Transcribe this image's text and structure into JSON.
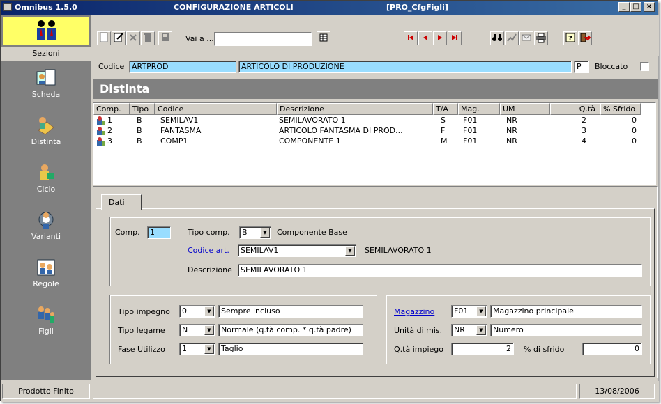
{
  "window": {
    "app_title": "Omnibus 1.5.0",
    "form_title": "CONFIGURAZIONE ARTICOLI",
    "form_code": "[PRO_CfgFigli]",
    "minimize": "_",
    "maximize": "□",
    "close": "×"
  },
  "sidebar": {
    "header": "Sezioni",
    "items": [
      {
        "label": "Scheda",
        "icon": "scheda-icon"
      },
      {
        "label": "Distinta",
        "icon": "distinta-icon"
      },
      {
        "label": "Ciclo",
        "icon": "ciclo-icon"
      },
      {
        "label": "Varianti",
        "icon": "varianti-icon"
      },
      {
        "label": "Regole",
        "icon": "regole-icon"
      },
      {
        "label": "Figli",
        "icon": "figli-icon"
      }
    ]
  },
  "toolbar": {
    "goto_label": "Vai a ...",
    "goto_value": ""
  },
  "header": {
    "codice_label": "Codice",
    "codice_value": "ARTPROD",
    "descrizione_value": "ARTICOLO DI PRODUZIONE",
    "tipo_value": "P",
    "bloccato_label": "Bloccato"
  },
  "distinta": {
    "title": "Distinta",
    "columns": [
      "Comp.",
      "Tipo",
      "Codice",
      "Descrizione",
      "T/A",
      "Mag.",
      "UM",
      "Q.tà",
      "% Sfrido"
    ],
    "rows": [
      {
        "comp": "1",
        "tipo": "B",
        "codice": "SEMILAV1",
        "descrizione": "SEMILAVORATO 1",
        "ta": "S",
        "mag": "F01",
        "um": "NR",
        "qta": "2",
        "sfrido": "0"
      },
      {
        "comp": "2",
        "tipo": "B",
        "codice": "FANTASMA",
        "descrizione": "ARTICOLO FANTASMA DI PROD...",
        "ta": "F",
        "mag": "F01",
        "um": "NR",
        "qta": "3",
        "sfrido": "0"
      },
      {
        "comp": "3",
        "tipo": "B",
        "codice": "COMP1",
        "descrizione": "COMPONENTE 1",
        "ta": "M",
        "mag": "F01",
        "um": "NR",
        "qta": "4",
        "sfrido": "0"
      }
    ]
  },
  "tabs": [
    {
      "label": "Dati"
    }
  ],
  "dati": {
    "comp_label": "Comp.",
    "comp_value": "1",
    "tipo_comp_label": "Tipo comp.",
    "tipo_comp_value": "B",
    "tipo_comp_desc": "Componente Base",
    "codice_art_label": "Codice art.",
    "codice_art_value": "SEMILAV1",
    "codice_art_desc": "SEMILAVORATO 1",
    "descrizione_label": "Descrizione",
    "descrizione_value": "SEMILAVORATO 1",
    "tipo_impegno_label": "Tipo impegno",
    "tipo_impegno_value": "0",
    "tipo_impegno_desc": "Sempre incluso",
    "tipo_legame_label": "Tipo legame",
    "tipo_legame_value": "N",
    "tipo_legame_desc": "Normale (q.tà comp. * q.tà padre)",
    "fase_label": "Fase Utilizzo",
    "fase_value": "1",
    "fase_desc": "Taglio",
    "magazzino_label": "Magazzino",
    "magazzino_value": "F01",
    "magazzino_desc": "Magazzino principale",
    "unita_label": "Unità di mis.",
    "unita_value": "NR",
    "unita_desc": "Numero",
    "qta_label": "Q.tà impiego",
    "qta_value": "2",
    "sfrido_label": "% di sfrido",
    "sfrido_value": "0"
  },
  "status": {
    "left": "Prodotto Finito",
    "date": "13/08/2006"
  }
}
